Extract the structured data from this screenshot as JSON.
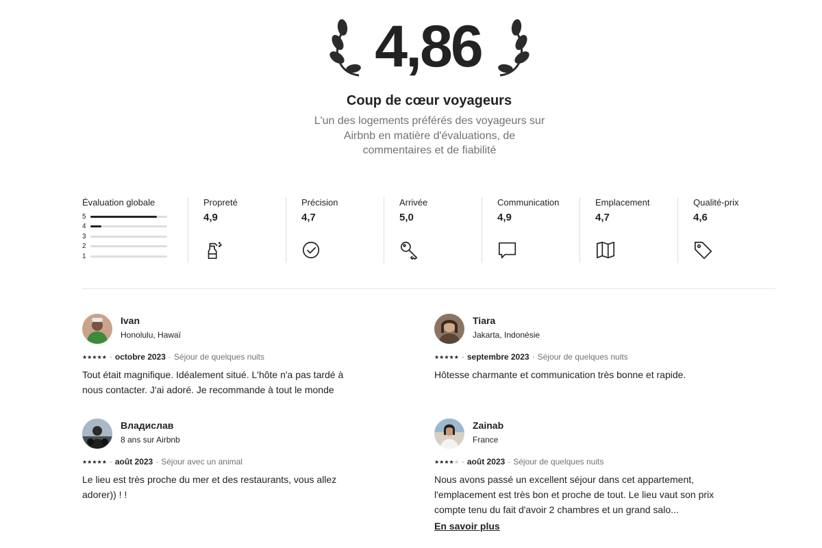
{
  "hero": {
    "rating": "4,86",
    "title": "Coup de cœur voyageurs",
    "subtitle": "L'un des logements préférés des voyageurs sur Airbnb en matière d'évaluations, de commentaires et de fiabilité"
  },
  "overall": {
    "label": "Évaluation globale",
    "rows": [
      {
        "num": "5",
        "fraction": 0.87
      },
      {
        "num": "4",
        "fraction": 0.14
      },
      {
        "num": "3",
        "fraction": 0
      },
      {
        "num": "2",
        "fraction": 0
      },
      {
        "num": "1",
        "fraction": 0
      }
    ]
  },
  "categories": [
    {
      "label": "Propreté",
      "value": "4,9",
      "icon": "cleaning-spray-icon"
    },
    {
      "label": "Précision",
      "value": "4,7",
      "icon": "check-circle-icon"
    },
    {
      "label": "Arrivée",
      "value": "5,0",
      "icon": "key-icon"
    },
    {
      "label": "Communication",
      "value": "4,9",
      "icon": "chat-bubble-icon"
    },
    {
      "label": "Emplacement",
      "value": "4,7",
      "icon": "map-icon"
    },
    {
      "label": "Qualité-prix",
      "value": "4,6",
      "icon": "price-tag-icon"
    }
  ],
  "reviews": [
    {
      "name": "Ivan",
      "location": "Honolulu, Hawaï",
      "stars": 5,
      "date": "octobre 2023",
      "stay": "Séjour de quelques nuits",
      "text": "Tout était magnifique. Idéalement situé. L'hôte n'a pas tardé à nous contacter. J'ai adoré. Je recommande à tout le monde"
    },
    {
      "name": "Tiara",
      "location": "Jakarta, Indonésie",
      "stars": 5,
      "date": "septembre 2023",
      "stay": "Séjour de quelques nuits",
      "text": "Hôtesse charmante et communication très bonne et rapide."
    },
    {
      "name": "Владислав",
      "location": "8 ans sur Airbnb",
      "stars": 5,
      "date": "août 2023",
      "stay": "Séjour avec un animal",
      "text": "Le lieu est très proche du mer et des restaurants, vous allez adorer)) ! !"
    },
    {
      "name": "Zainab",
      "location": "France",
      "stars": 4,
      "date": "août 2023",
      "stay": "Séjour de quelques nuits",
      "text": "Nous avons passé un excellent séjour dans cet appartement, l'emplacement est très bon et proche de tout. Le lieu vaut son prix compte tenu du fait d'avoir 2 chambres et un grand salo...",
      "more": "En savoir plus"
    }
  ],
  "colors": {
    "text": "#222222",
    "muted": "#717171",
    "track": "#dddddd"
  }
}
